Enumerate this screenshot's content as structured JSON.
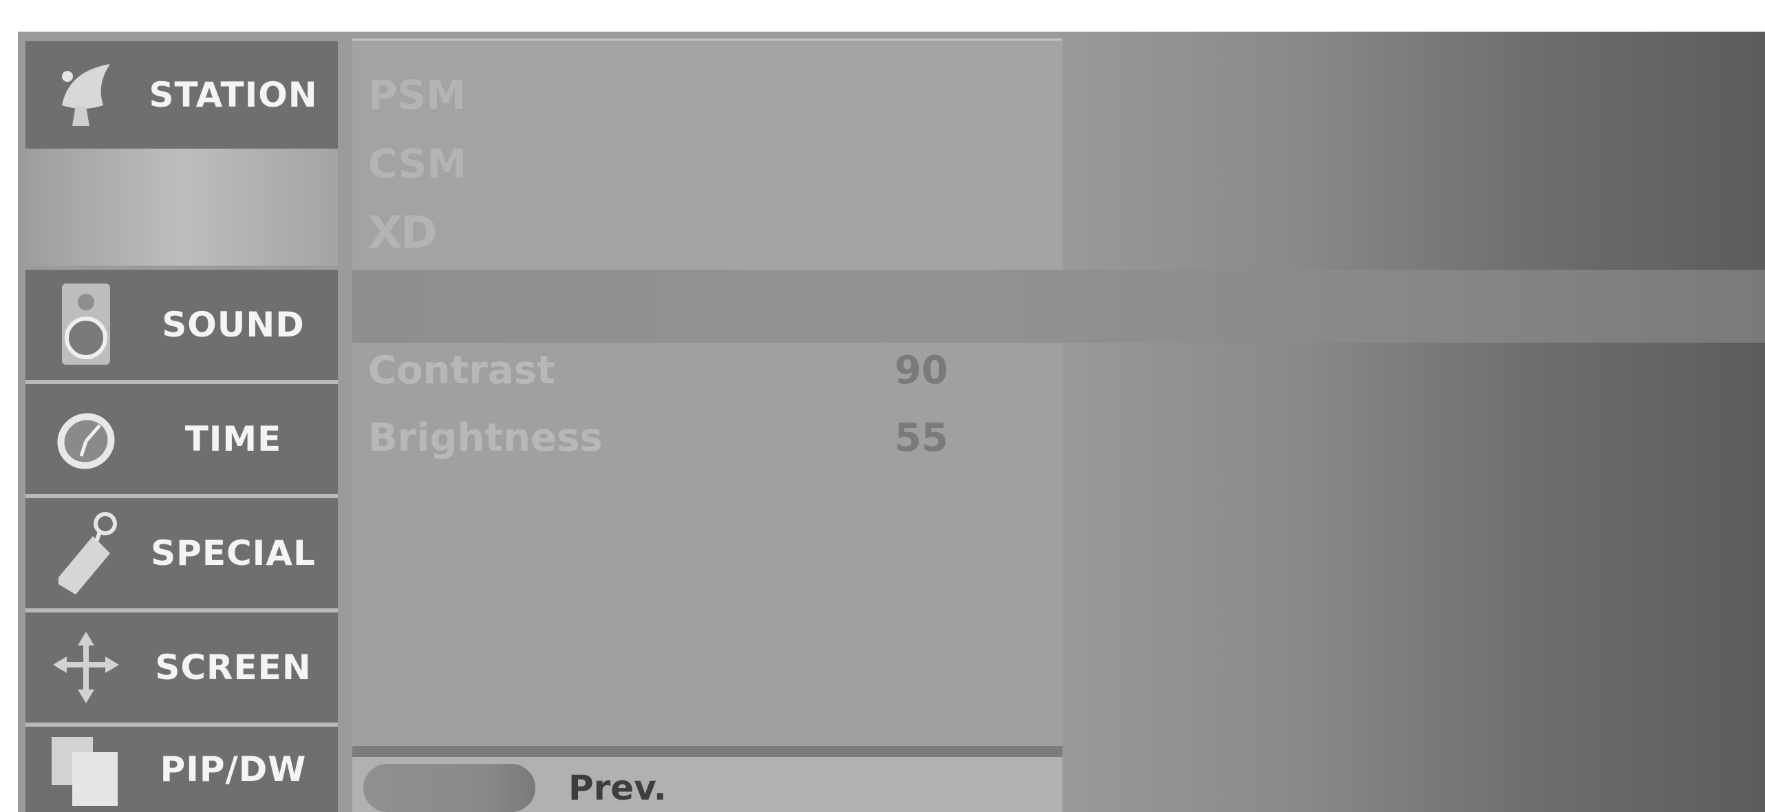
{
  "sidebar": {
    "items": [
      {
        "label": "STATION",
        "icon": "satellite-dish-icon"
      },
      {
        "label": "SOUND",
        "icon": "speaker-icon"
      },
      {
        "label": "TIME",
        "icon": "clock-icon"
      },
      {
        "label": "SPECIAL",
        "icon": "tag-icon"
      },
      {
        "label": "SCREEN",
        "icon": "move-arrows-icon"
      },
      {
        "label": "PIP/DW",
        "icon": "pip-icon"
      }
    ]
  },
  "picture_menu": {
    "items": [
      "PSM",
      "CSM",
      "XD"
    ],
    "settings": [
      {
        "name": "Contrast",
        "value": "90"
      },
      {
        "name": "Brightness",
        "value": "55"
      }
    ]
  },
  "footer": {
    "prev_label": "Prev."
  },
  "colors": {
    "tile": "#6f6f6f",
    "panel": "#a0a0a0",
    "text_light": "#f4f4f4"
  }
}
